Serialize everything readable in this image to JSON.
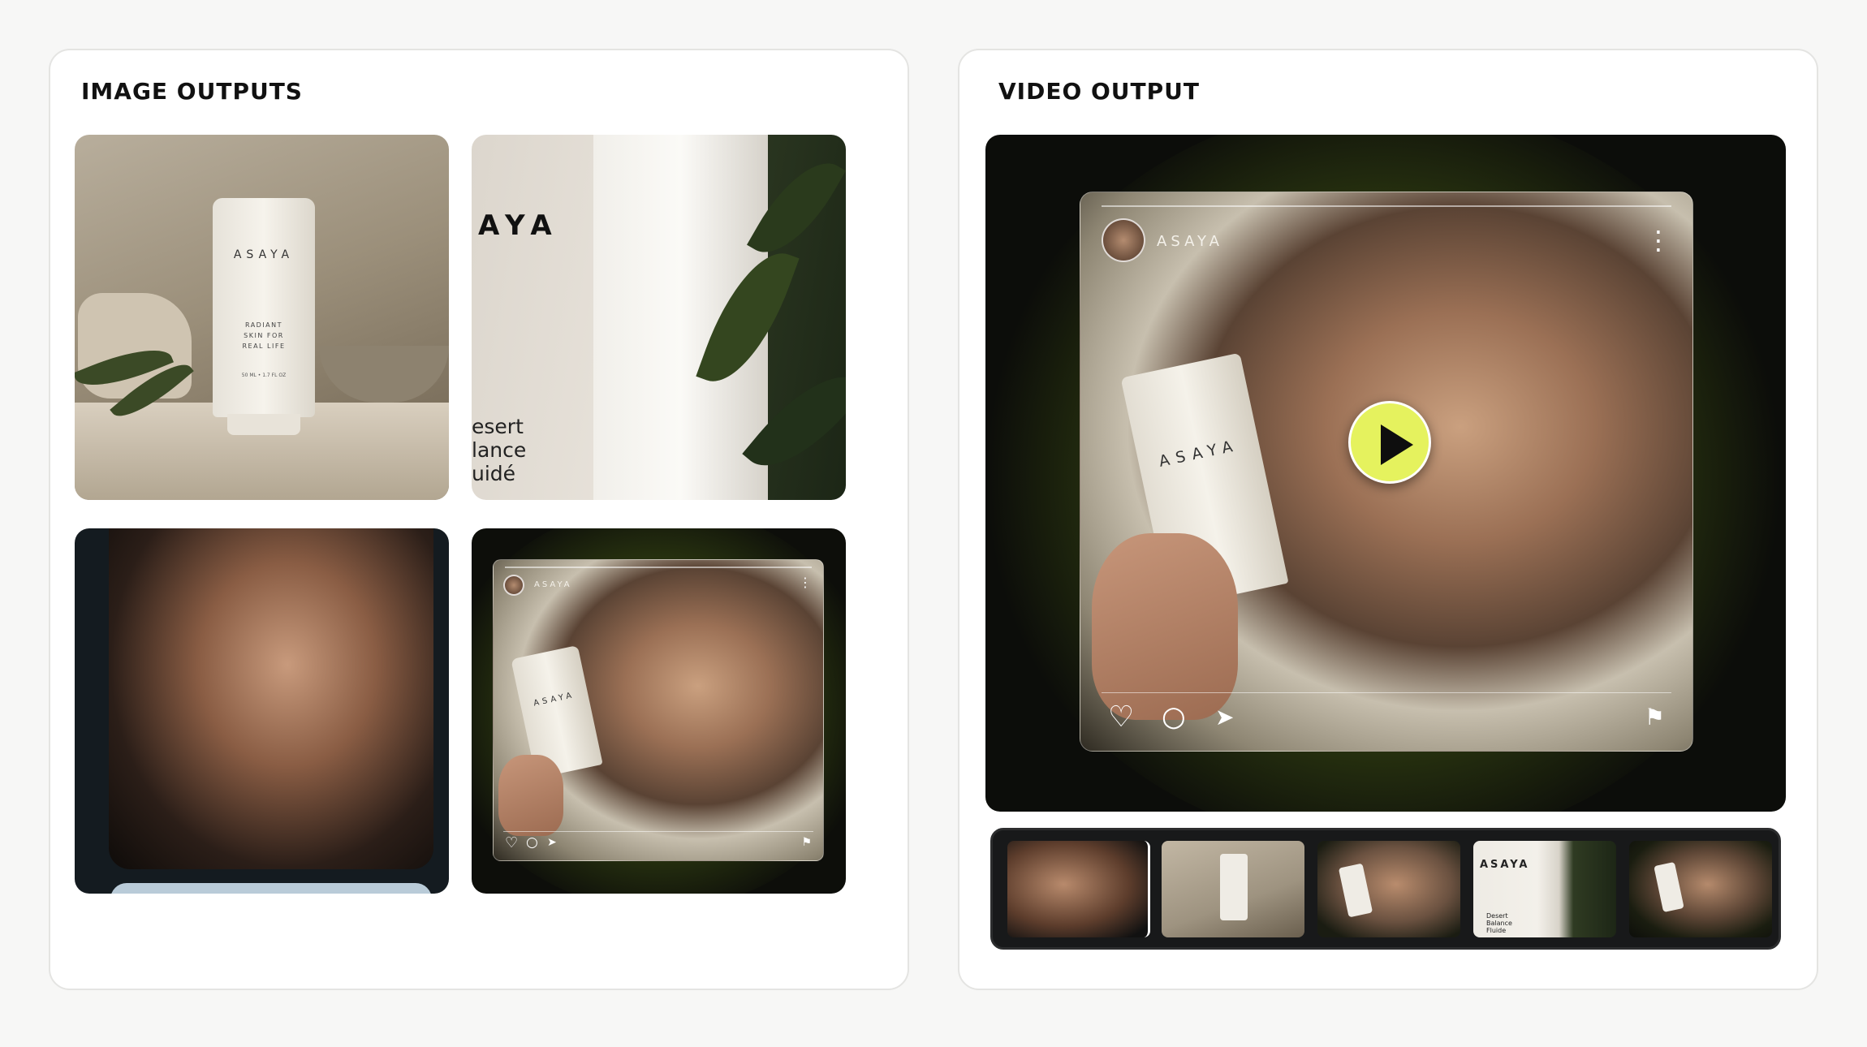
{
  "image_panel": {
    "title": "IMAGE OUTPUTS",
    "tile1": {
      "brand": "ASAYA",
      "tagline": [
        "RADIANT",
        "SKIN FOR",
        "REAL LIFE"
      ],
      "size": "50 ML • 1.7 FL OZ"
    },
    "tile2": {
      "brand_fragment": "AYA",
      "lines": [
        "esert",
        "lance",
        "uidé"
      ]
    },
    "tile4": {
      "username": "ASAYA",
      "product_brand": "ASAYA"
    }
  },
  "video_panel": {
    "title": "VIDEO OUTPUT",
    "post": {
      "username": "ASAYA",
      "product_brand": "ASAYA",
      "more_icon": "more-vertical-icon"
    },
    "play_button_color": "#e5f25e",
    "filmstrip": {
      "thumb4_brand": "ASAYA",
      "thumb4_lines": [
        "Desert",
        "Balance",
        "Fluide"
      ]
    }
  },
  "icons": {
    "heart": "♡",
    "comment": "○",
    "share": "➤",
    "bookmark": "⚑",
    "more": "⋮"
  },
  "colors": {
    "background": "#f7f7f6",
    "panel": "#ffffff",
    "accent_play": "#e5f25e",
    "glow_green": "#3b4a1c"
  }
}
